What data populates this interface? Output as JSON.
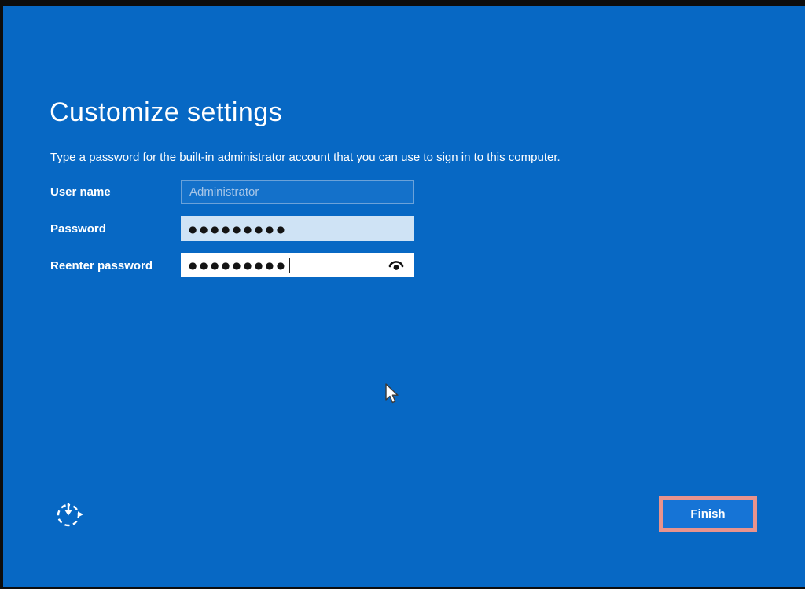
{
  "screen": {
    "title": "Customize settings",
    "subtitle": "Type a password for the built-in administrator account that you can use to sign in to this computer."
  },
  "form": {
    "username": {
      "label": "User name",
      "value": "",
      "placeholder": "Administrator",
      "state": "disabled"
    },
    "password": {
      "label": "Password",
      "masked_value": "●●●●●●●●●",
      "state": "filled"
    },
    "reenter": {
      "label": "Reenter password",
      "masked_value": "●●●●●●●●●",
      "state": "focused-with-caret"
    }
  },
  "buttons": {
    "finish": {
      "label": "Finish",
      "highlighted": true
    }
  },
  "icons": {
    "password_reveal": "eye-icon",
    "ease_of_access": "ease-of-access-icon",
    "pointer": "mouse-cursor"
  },
  "colors": {
    "background": "#0768c4",
    "frame_edge": "#0d0d0d",
    "button_blue": "#1674d6",
    "highlight_border": "#e8938d",
    "password_field_fill": "#cfe3f5",
    "reenter_field_fill": "#ffffff",
    "username_field_fill": "#1471ca",
    "text_white": "#ffffff"
  }
}
